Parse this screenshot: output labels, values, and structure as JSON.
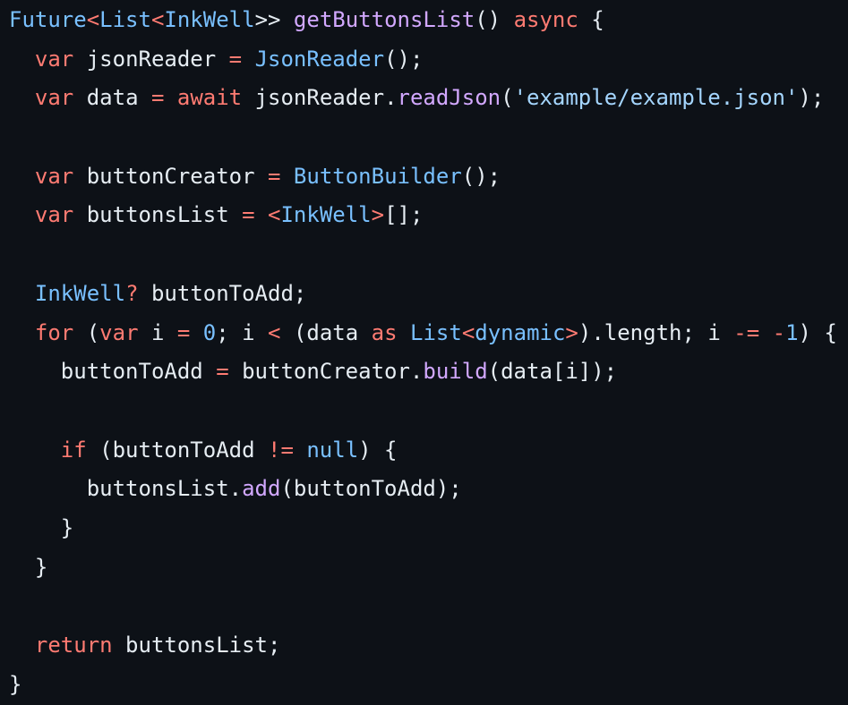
{
  "code_block": {
    "language": "dart",
    "colors": {
      "background": "#0d1117",
      "default": "#e6edf3",
      "type": "#79c0ff",
      "keyword": "#ff7b72",
      "function": "#d2a8ff",
      "string": "#a5d6ff",
      "number": "#79c0ff",
      "operator": "#ff7b72"
    },
    "lines": [
      [
        {
          "t": "Future",
          "c": "type"
        },
        {
          "t": "<",
          "c": "operator"
        },
        {
          "t": "List",
          "c": "type"
        },
        {
          "t": "<",
          "c": "operator"
        },
        {
          "t": "InkWell",
          "c": "type"
        },
        {
          "t": ">> ",
          "c": "default"
        },
        {
          "t": "getButtonsList",
          "c": "function"
        },
        {
          "t": "() ",
          "c": "default"
        },
        {
          "t": "async",
          "c": "keyword"
        },
        {
          "t": " {",
          "c": "default"
        }
      ],
      [
        {
          "t": "  ",
          "c": "default"
        },
        {
          "t": "var",
          "c": "keyword"
        },
        {
          "t": " jsonReader ",
          "c": "default"
        },
        {
          "t": "=",
          "c": "operator"
        },
        {
          "t": " ",
          "c": "default"
        },
        {
          "t": "JsonReader",
          "c": "type"
        },
        {
          "t": "();",
          "c": "default"
        }
      ],
      [
        {
          "t": "  ",
          "c": "default"
        },
        {
          "t": "var",
          "c": "keyword"
        },
        {
          "t": " data ",
          "c": "default"
        },
        {
          "t": "=",
          "c": "operator"
        },
        {
          "t": " ",
          "c": "default"
        },
        {
          "t": "await",
          "c": "keyword"
        },
        {
          "t": " jsonReader.",
          "c": "default"
        },
        {
          "t": "readJson",
          "c": "function"
        },
        {
          "t": "(",
          "c": "default"
        },
        {
          "t": "'example/example.json'",
          "c": "string"
        },
        {
          "t": ");",
          "c": "default"
        }
      ],
      [],
      [
        {
          "t": "  ",
          "c": "default"
        },
        {
          "t": "var",
          "c": "keyword"
        },
        {
          "t": " buttonCreator ",
          "c": "default"
        },
        {
          "t": "=",
          "c": "operator"
        },
        {
          "t": " ",
          "c": "default"
        },
        {
          "t": "ButtonBuilder",
          "c": "type"
        },
        {
          "t": "();",
          "c": "default"
        }
      ],
      [
        {
          "t": "  ",
          "c": "default"
        },
        {
          "t": "var",
          "c": "keyword"
        },
        {
          "t": " buttonsList ",
          "c": "default"
        },
        {
          "t": "=",
          "c": "operator"
        },
        {
          "t": " ",
          "c": "default"
        },
        {
          "t": "<",
          "c": "operator"
        },
        {
          "t": "InkWell",
          "c": "type"
        },
        {
          "t": ">",
          "c": "operator"
        },
        {
          "t": "[];",
          "c": "default"
        }
      ],
      [],
      [
        {
          "t": "  ",
          "c": "default"
        },
        {
          "t": "InkWell",
          "c": "type"
        },
        {
          "t": "?",
          "c": "operator"
        },
        {
          "t": " buttonToAdd;",
          "c": "default"
        }
      ],
      [
        {
          "t": "  ",
          "c": "default"
        },
        {
          "t": "for",
          "c": "keyword"
        },
        {
          "t": " (",
          "c": "default"
        },
        {
          "t": "var",
          "c": "keyword"
        },
        {
          "t": " i ",
          "c": "default"
        },
        {
          "t": "=",
          "c": "operator"
        },
        {
          "t": " ",
          "c": "default"
        },
        {
          "t": "0",
          "c": "number"
        },
        {
          "t": "; i ",
          "c": "default"
        },
        {
          "t": "<",
          "c": "operator"
        },
        {
          "t": " (data ",
          "c": "default"
        },
        {
          "t": "as",
          "c": "keyword"
        },
        {
          "t": " ",
          "c": "default"
        },
        {
          "t": "List",
          "c": "type"
        },
        {
          "t": "<",
          "c": "operator"
        },
        {
          "t": "dynamic",
          "c": "type"
        },
        {
          "t": ">",
          "c": "operator"
        },
        {
          "t": ").length; i ",
          "c": "default"
        },
        {
          "t": "-=",
          "c": "operator"
        },
        {
          "t": " ",
          "c": "default"
        },
        {
          "t": "-",
          "c": "operator"
        },
        {
          "t": "1",
          "c": "number"
        },
        {
          "t": ") {",
          "c": "default"
        }
      ],
      [
        {
          "t": "    buttonToAdd ",
          "c": "default"
        },
        {
          "t": "=",
          "c": "operator"
        },
        {
          "t": " buttonCreator.",
          "c": "default"
        },
        {
          "t": "build",
          "c": "function"
        },
        {
          "t": "(data[i]);",
          "c": "default"
        }
      ],
      [],
      [
        {
          "t": "    ",
          "c": "default"
        },
        {
          "t": "if",
          "c": "keyword"
        },
        {
          "t": " (buttonToAdd ",
          "c": "default"
        },
        {
          "t": "!=",
          "c": "operator"
        },
        {
          "t": " ",
          "c": "default"
        },
        {
          "t": "null",
          "c": "type"
        },
        {
          "t": ") {",
          "c": "default"
        }
      ],
      [
        {
          "t": "      buttonsList.",
          "c": "default"
        },
        {
          "t": "add",
          "c": "function"
        },
        {
          "t": "(buttonToAdd);",
          "c": "default"
        }
      ],
      [
        {
          "t": "    }",
          "c": "default"
        }
      ],
      [
        {
          "t": "  }",
          "c": "default"
        }
      ],
      [],
      [
        {
          "t": "  ",
          "c": "default"
        },
        {
          "t": "return",
          "c": "keyword"
        },
        {
          "t": " buttonsList;",
          "c": "default"
        }
      ],
      [
        {
          "t": "}",
          "c": "default"
        }
      ]
    ]
  }
}
